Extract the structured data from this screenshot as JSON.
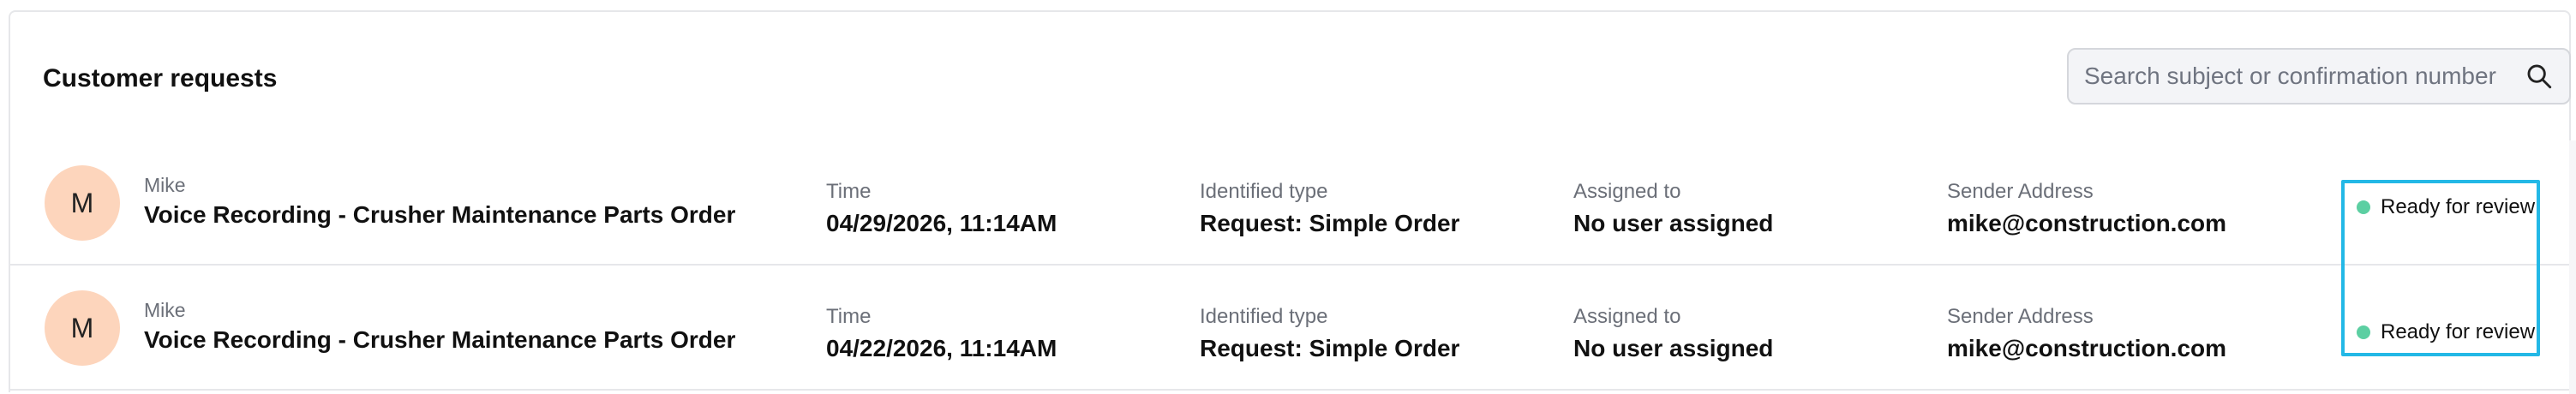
{
  "header": {
    "title": "Customer requests"
  },
  "search": {
    "placeholder": "Search subject or confirmation number",
    "icon": "search-icon"
  },
  "colors": {
    "avatar_bg": "#fdd5bc",
    "status_dot": "#5ccfa2",
    "highlight_border": "#23b8e6"
  },
  "rows": [
    {
      "avatar_initial": "M",
      "sender_name": "Mike",
      "subject": "Voice Recording - Crusher Maintenance Parts Order",
      "time_label": "Time",
      "time_value": "04/29/2026, 11:14AM",
      "type_label": "Identified type",
      "type_value": "Request: Simple Order",
      "assigned_label": "Assigned to",
      "assigned_value": "No user assigned",
      "address_label": "Sender Address",
      "address_value": "mike@construction.com",
      "status": "Ready for review"
    },
    {
      "avatar_initial": "M",
      "sender_name": "Mike",
      "subject": "Voice Recording - Crusher Maintenance Parts Order",
      "time_label": "Time",
      "time_value": "04/22/2026, 11:14AM",
      "type_label": "Identified type",
      "type_value": "Request: Simple Order",
      "assigned_label": "Assigned to",
      "assigned_value": "No user assigned",
      "address_label": "Sender Address",
      "address_value": "mike@construction.com",
      "status": "Ready for review"
    }
  ]
}
